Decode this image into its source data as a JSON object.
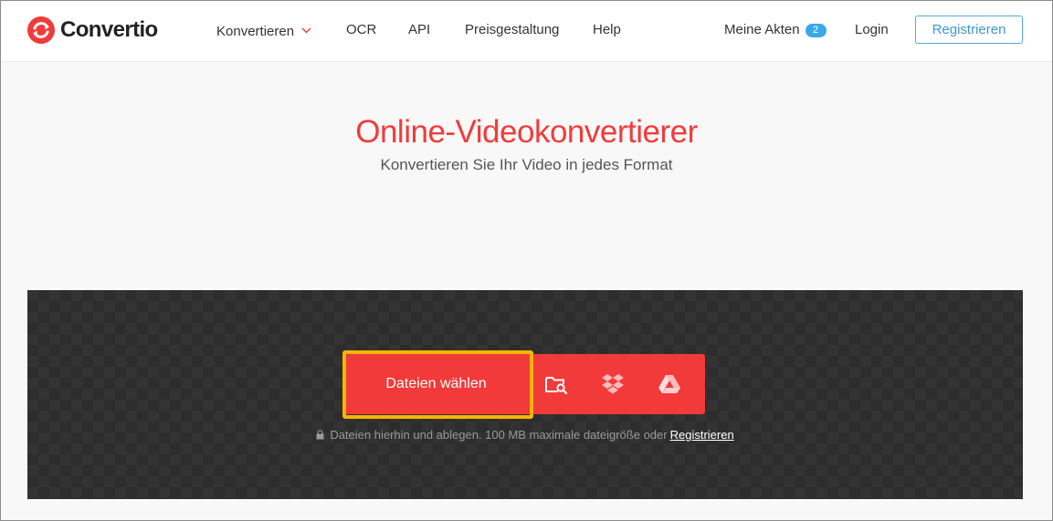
{
  "header": {
    "logo_text": "Convertio",
    "nav": [
      {
        "label": "Konvertieren"
      },
      {
        "label": "OCR"
      },
      {
        "label": "API"
      },
      {
        "label": "Preisgestaltung"
      },
      {
        "label": "Help"
      }
    ],
    "my_files": {
      "label": "Meine Akten",
      "count": "2"
    },
    "login_label": "Login",
    "register_label": "Registrieren"
  },
  "hero": {
    "title": "Online-Videokonvertierer",
    "subtitle": "Konvertieren Sie Ihr Video in jedes Format"
  },
  "upload": {
    "choose_label": "Dateien wählen",
    "sources": [
      "folder-search-icon",
      "dropbox-icon",
      "google-drive-icon"
    ],
    "hint_text": "Dateien hierhin und ablegen. 100 MB maximale dateigröße oder",
    "hint_link": "Registrieren"
  },
  "colors": {
    "brand": "#f23a3a",
    "accent_blue": "#3aa8e8",
    "highlight": "#f7b500",
    "upload_bg": "#333333"
  }
}
